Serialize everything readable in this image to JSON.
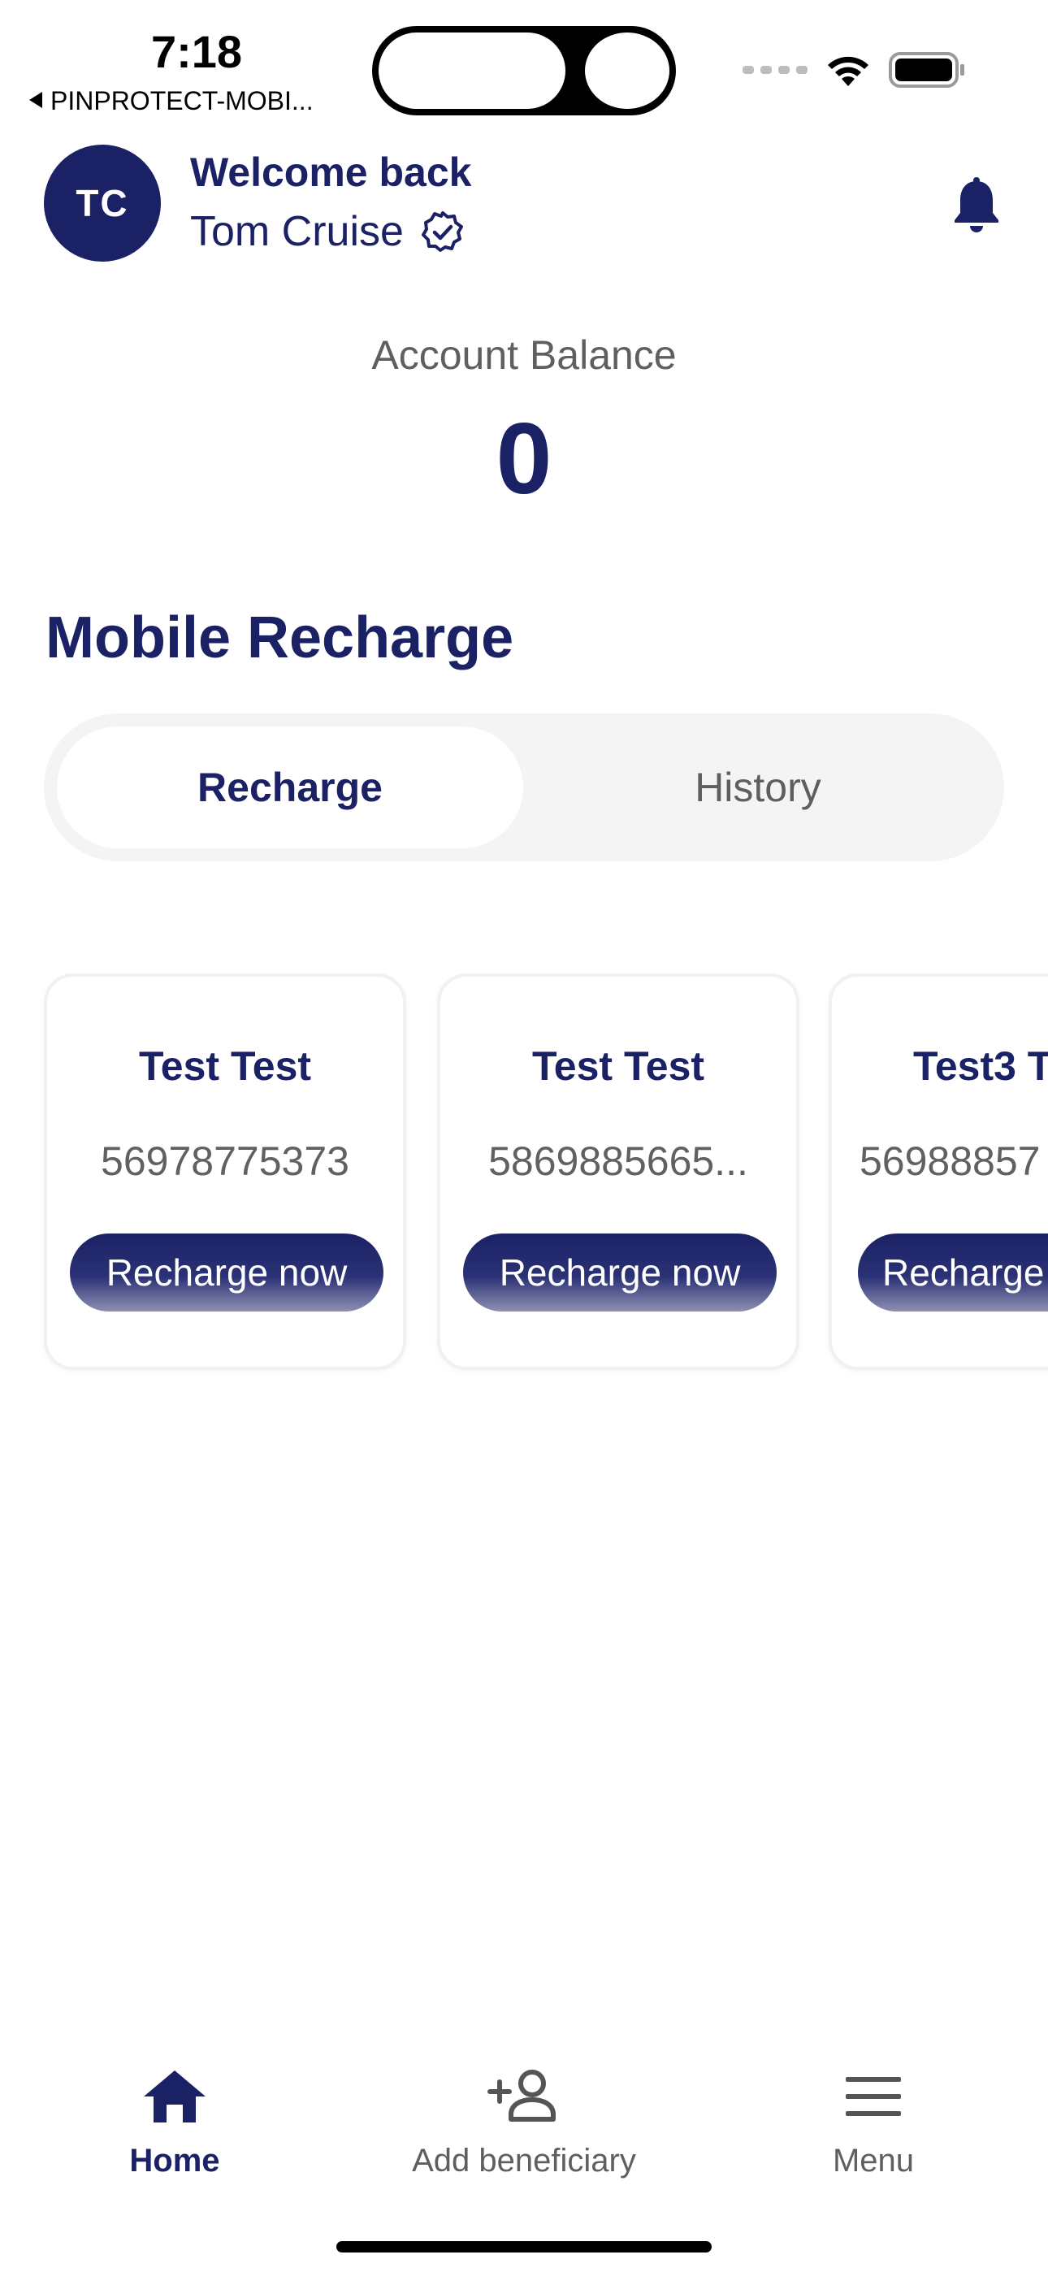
{
  "status_bar": {
    "time": "7:18",
    "back_app": "PINPROTECT-MOBI..."
  },
  "header": {
    "avatar_initials": "TC",
    "welcome": "Welcome back",
    "user_name": "Tom Cruise"
  },
  "balance": {
    "label": "Account Balance",
    "value": "0"
  },
  "section": {
    "title": "Mobile Recharge"
  },
  "tabs": [
    {
      "label": "Recharge",
      "active": true
    },
    {
      "label": "History",
      "active": false
    }
  ],
  "beneficiaries": [
    {
      "name": "Test Test",
      "phone": "56978775373",
      "button": "Recharge now"
    },
    {
      "name": "Test Test",
      "phone": "5869885665...",
      "button": "Recharge now"
    },
    {
      "name": "Test3 T",
      "phone": "56988857",
      "button": "Recharge"
    }
  ],
  "bottom_nav": [
    {
      "label": "Home",
      "icon": "home-icon",
      "active": true
    },
    {
      "label": "Add beneficiary",
      "icon": "add-person-icon",
      "active": false
    },
    {
      "label": "Menu",
      "icon": "menu-icon",
      "active": false
    }
  ],
  "colors": {
    "primary": "#1b2165",
    "text_muted": "#5f5f5f",
    "segment_bg": "#f4f4f4"
  }
}
